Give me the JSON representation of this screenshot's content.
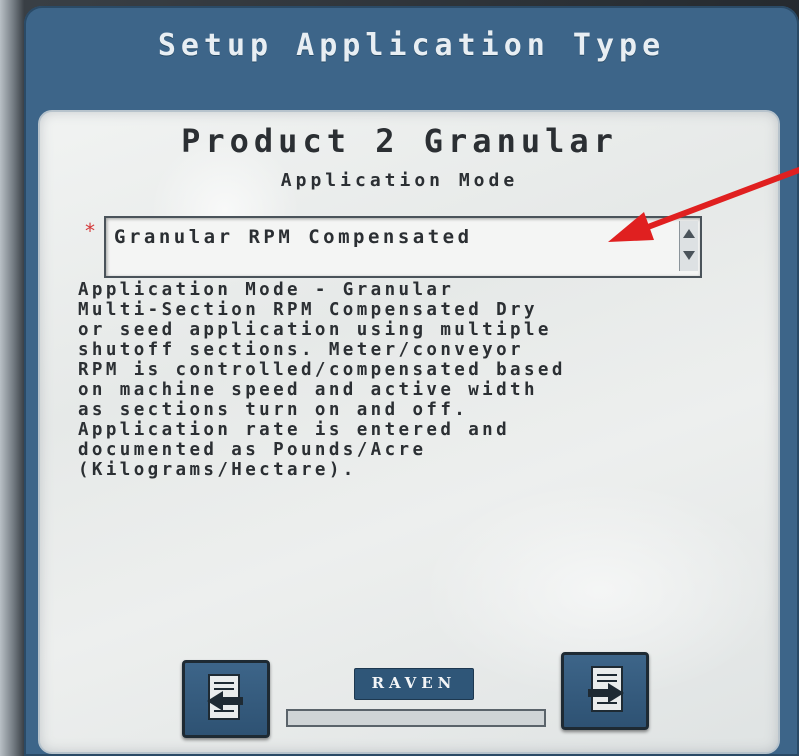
{
  "window": {
    "title": "Setup Application Type"
  },
  "panel": {
    "product_title": "Product 2 Granular",
    "section_label": "Application Mode",
    "required_marker": "*"
  },
  "application_mode_select": {
    "selected_value": "Granular RPM Compensated"
  },
  "description": {
    "lines": [
      "Application Mode - Granular",
      "Multi-Section RPM Compensated  Dry",
      "or seed application using multiple",
      "shutoff sections.  Meter/conveyor",
      "RPM is controlled/compensated based",
      "on machine speed and active width",
      "as sections turn on and off.",
      "Application rate is entered and",
      "documented as Pounds/Acre",
      "(Kilograms/Hectare)."
    ]
  },
  "footer": {
    "brand": "RAVEN",
    "progress_fraction": 0
  },
  "colors": {
    "header_blue": "#3d6589",
    "panel_bg": "#eceeed",
    "annotation_arrow": "#e02020",
    "required_star": "#d43a3a"
  },
  "icons": {
    "back": "document-back-arrow-icon",
    "next": "document-next-arrow-icon",
    "spinner": "up-down-spinner-icon"
  }
}
